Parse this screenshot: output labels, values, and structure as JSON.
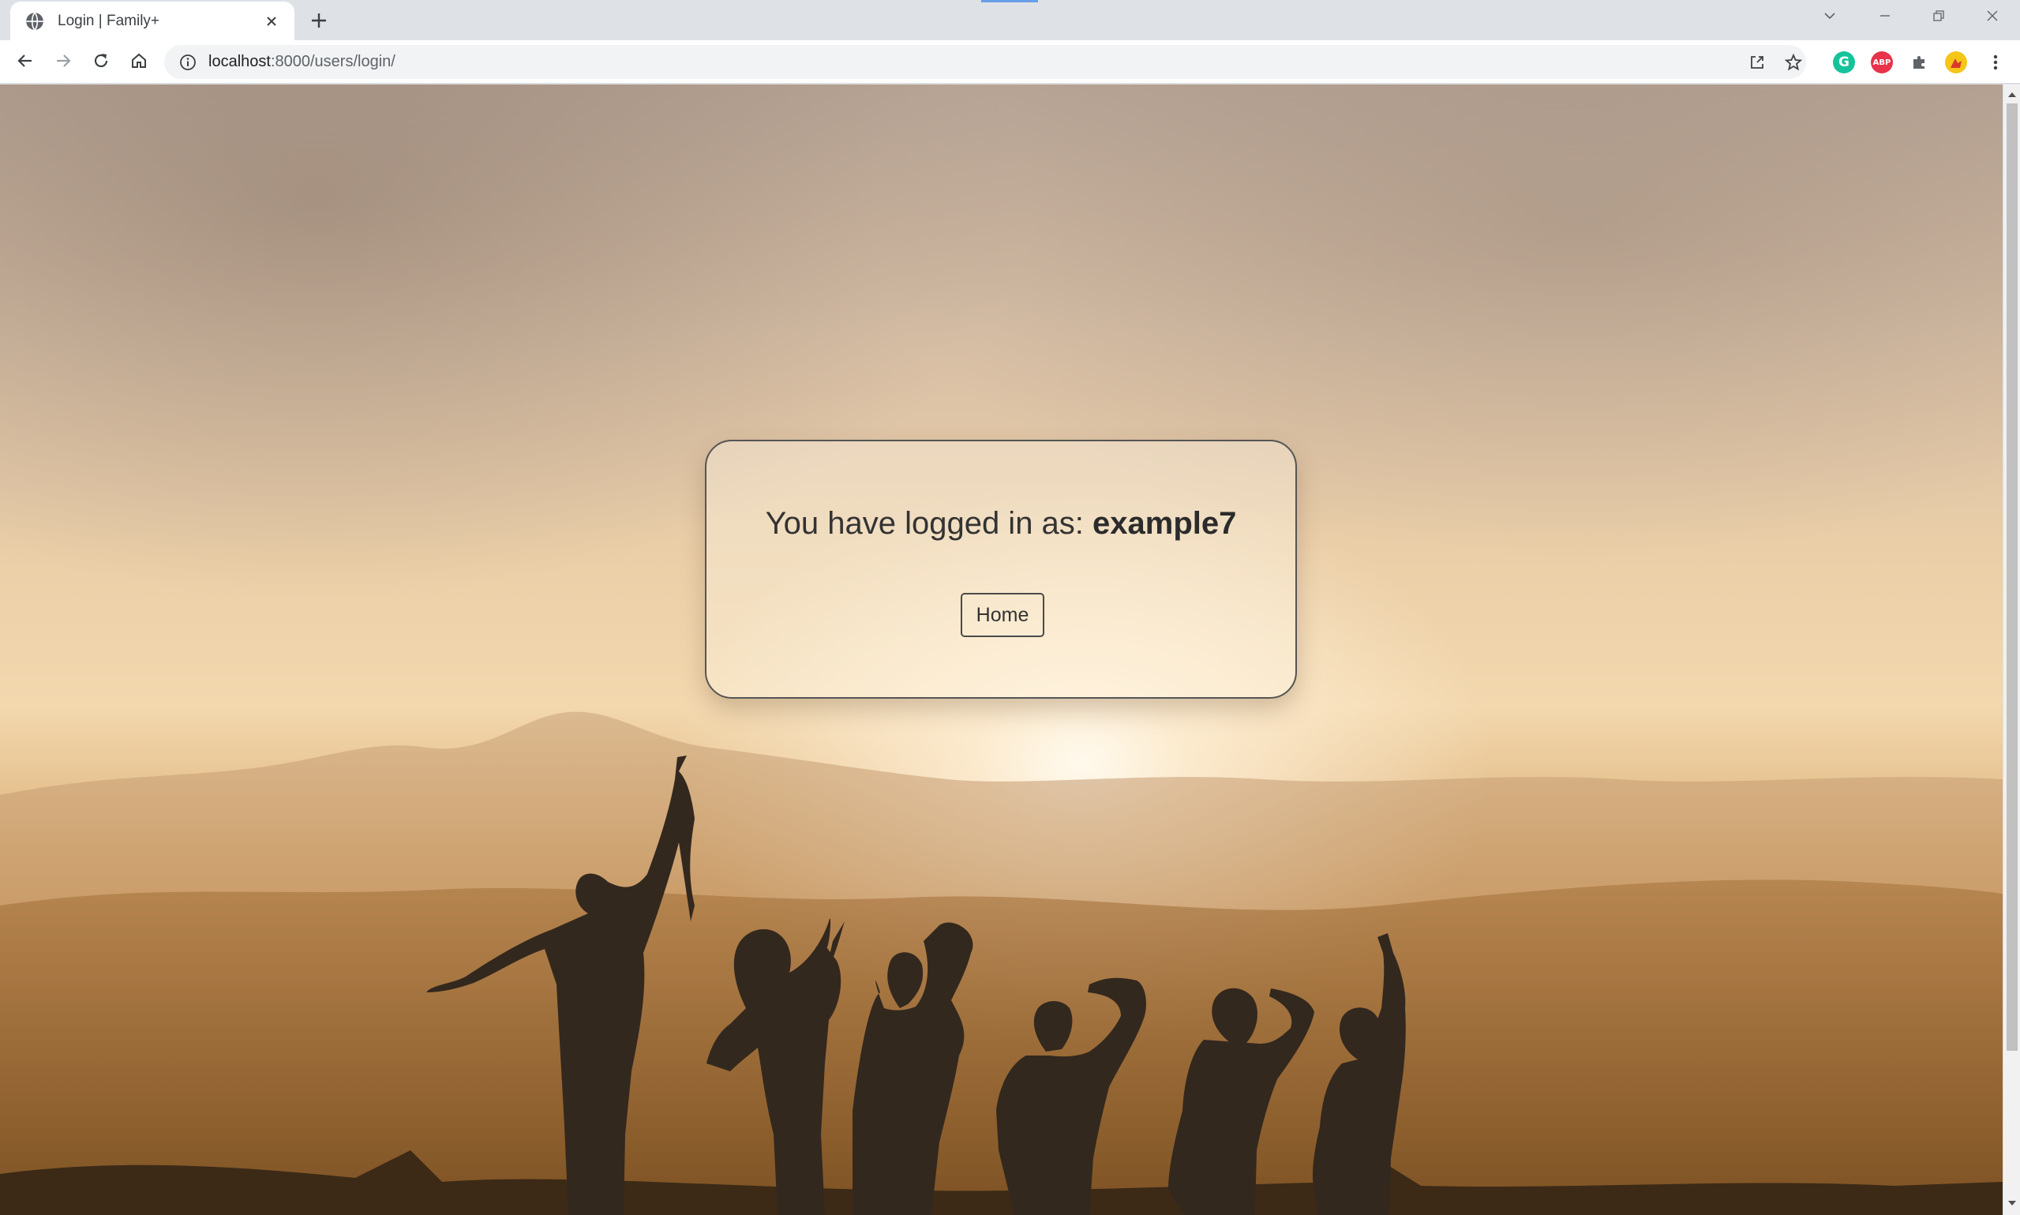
{
  "browser": {
    "tab": {
      "title": "Login | Family+",
      "favicon": "globe-icon"
    },
    "new_tab_icon": "plus-icon",
    "window_controls": [
      "tab-search-icon",
      "minimize-icon",
      "restore-icon",
      "close-icon"
    ],
    "toolbar": {
      "back_icon": "back-arrow-icon",
      "forward_icon": "forward-arrow-icon",
      "reload_icon": "reload-icon",
      "home_icon": "home-icon",
      "url_host": "localhost",
      "url_rest": ":8000/users/login/",
      "info_icon": "info-icon",
      "share_icon": "share-icon",
      "bookmark_icon": "star-icon"
    },
    "extensions": [
      {
        "name": "grammarly-icon",
        "letter": "G",
        "color": "#15c39a"
      },
      {
        "name": "adblock-plus-icon",
        "letter": "ABP",
        "color": "#e8334a"
      },
      {
        "name": "extensions-puzzle-icon",
        "letter": "",
        "color": "#5f6368"
      },
      {
        "name": "profile-avatar-icon",
        "letter": "",
        "color": "#f5c518"
      }
    ],
    "menu_icon": "kebab-menu-icon"
  },
  "page": {
    "background": "sunset-silhouette-people",
    "card": {
      "message_prefix": "You have logged in as: ",
      "username": "example7",
      "home_button_label": "Home"
    }
  },
  "colors": {
    "tabstrip_bg": "#dee1e6",
    "card_border": "#555555",
    "text": "#333333"
  }
}
